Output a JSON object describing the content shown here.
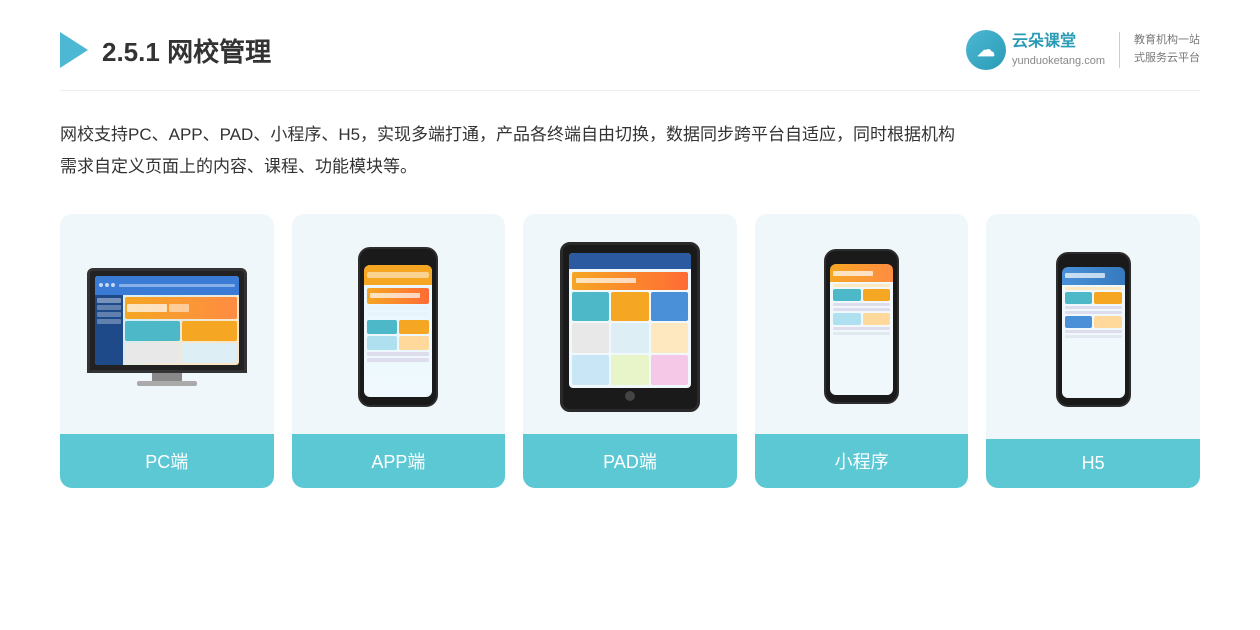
{
  "header": {
    "section_number": "2.5.1",
    "title_normal": "",
    "title_bold": "网校管理",
    "brand_name": "云朵课堂",
    "brand_site": "yunduoketang.com",
    "brand_slogan_line1": "教育机构一站",
    "brand_slogan_line2": "式服务云平台"
  },
  "description": {
    "text_line1": "网校支持PC、APP、PAD、小程序、H5，实现多端打通，产品各终端自由切换，数据同步跨平台自适应，同时根据机构",
    "text_line2": "需求自定义页面上的内容、课程、功能模块等。"
  },
  "cards": [
    {
      "id": "pc",
      "label": "PC端"
    },
    {
      "id": "app",
      "label": "APP端"
    },
    {
      "id": "pad",
      "label": "PAD端"
    },
    {
      "id": "miniprogram",
      "label": "小程序"
    },
    {
      "id": "h5",
      "label": "H5"
    }
  ]
}
